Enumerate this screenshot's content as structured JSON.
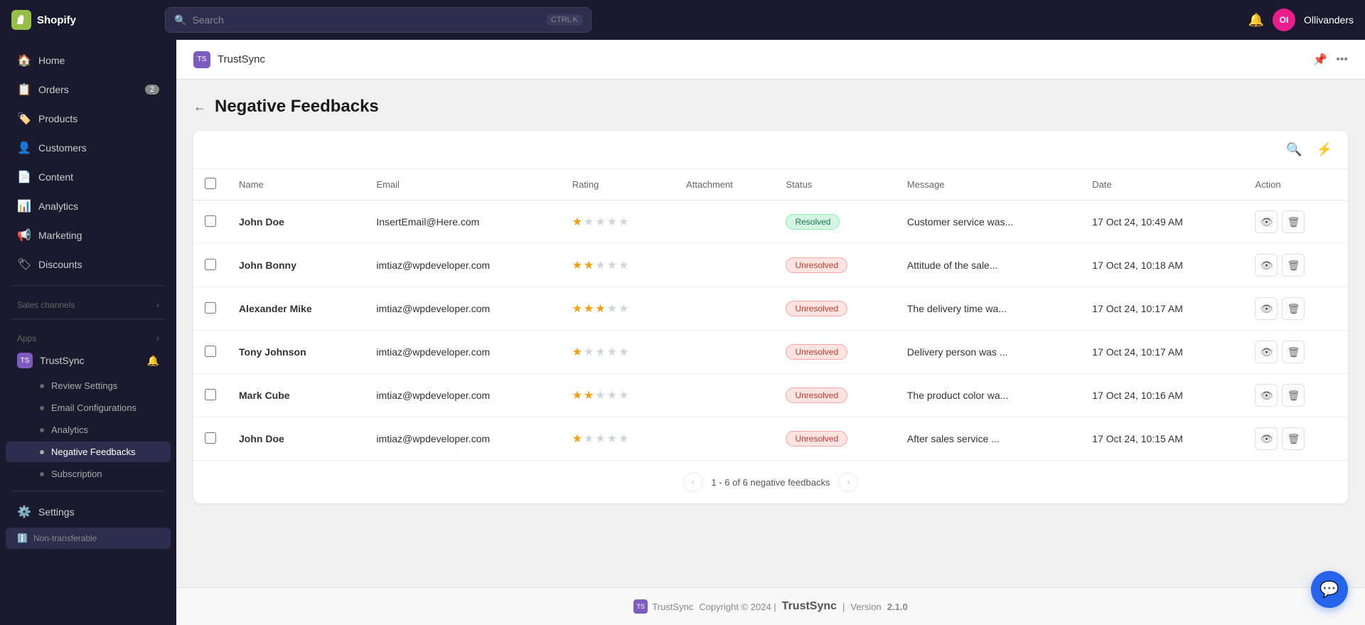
{
  "topbar": {
    "brand": "Shopify",
    "search_placeholder": "Search",
    "search_shortcut": [
      "CTRL",
      "K"
    ],
    "user_initials": "OI",
    "user_name": "Ollivanders"
  },
  "sidebar": {
    "nav_items": [
      {
        "id": "home",
        "label": "Home",
        "icon": "🏠",
        "badge": null
      },
      {
        "id": "orders",
        "label": "Orders",
        "icon": "📋",
        "badge": "2"
      },
      {
        "id": "products",
        "label": "Products",
        "icon": "🏷️",
        "badge": null
      },
      {
        "id": "customers",
        "label": "Customers",
        "icon": "👤",
        "badge": null
      },
      {
        "id": "content",
        "label": "Content",
        "icon": "📄",
        "badge": null
      },
      {
        "id": "analytics",
        "label": "Analytics",
        "icon": "📊",
        "badge": null
      },
      {
        "id": "marketing",
        "label": "Marketing",
        "icon": "📢",
        "badge": null
      },
      {
        "id": "discounts",
        "label": "Discounts",
        "icon": "🏷",
        "badge": null
      }
    ],
    "sales_channels_label": "Sales channels",
    "apps_label": "Apps",
    "trustsync_label": "TrustSync",
    "sub_items": [
      {
        "id": "review-settings",
        "label": "Review Settings"
      },
      {
        "id": "email-configurations",
        "label": "Email Configurations"
      },
      {
        "id": "analytics",
        "label": "Analytics"
      },
      {
        "id": "negative-feedbacks",
        "label": "Negative Feedbacks",
        "active": true
      }
    ],
    "subscription_label": "Subscription",
    "settings_label": "Settings",
    "non_transferable_label": "Non-transferable"
  },
  "app_header": {
    "icon_text": "TS",
    "title": "TrustSync",
    "pin_icon": "📌",
    "more_icon": "···"
  },
  "page": {
    "title": "Negative Feedbacks",
    "back_label": "←"
  },
  "table": {
    "columns": [
      "",
      "Name",
      "Email",
      "Rating",
      "Attachment",
      "Status",
      "Message",
      "Date",
      "Action"
    ],
    "rows": [
      {
        "name": "John Doe",
        "email": "InsertEmail@Here.com",
        "rating": 1,
        "attachment": "",
        "status": "Resolved",
        "status_type": "resolved",
        "message": "Customer service was...",
        "date": "17 Oct 24, 10:49 AM"
      },
      {
        "name": "John Bonny",
        "email": "imtiaz@wpdeveloper.com",
        "rating": 2,
        "attachment": "",
        "status": "Unresolved",
        "status_type": "unresolved",
        "message": "Attitude of the sale...",
        "date": "17 Oct 24, 10:18 AM"
      },
      {
        "name": "Alexander Mike",
        "email": "imtiaz@wpdeveloper.com",
        "rating": 3,
        "attachment": "",
        "status": "Unresolved",
        "status_type": "unresolved",
        "message": "The delivery time wa...",
        "date": "17 Oct 24, 10:17 AM"
      },
      {
        "name": "Tony Johnson",
        "email": "imtiaz@wpdeveloper.com",
        "rating": 1,
        "attachment": "",
        "status": "Unresolved",
        "status_type": "unresolved",
        "message": "Delivery person was ...",
        "date": "17 Oct 24, 10:17 AM"
      },
      {
        "name": "Mark Cube",
        "email": "imtiaz@wpdeveloper.com",
        "rating": 2,
        "attachment": "",
        "status": "Unresolved",
        "status_type": "unresolved",
        "message": "The product color wa...",
        "date": "17 Oct 24, 10:16 AM"
      },
      {
        "name": "John Doe",
        "email": "imtiaz@wpdeveloper.com",
        "rating": 1,
        "attachment": "",
        "status": "Unresolved",
        "status_type": "unresolved",
        "message": "After sales service ...",
        "date": "17 Oct 24, 10:15 AM"
      }
    ],
    "pagination": {
      "text": "1 - 6 of 6 negative feedbacks"
    }
  },
  "footer": {
    "icon_text": "TS",
    "brand": "TrustSync",
    "copyright": "Copyright © 2024 |",
    "separator": "|",
    "version_label": "Version",
    "version": "2.1.0"
  },
  "chat_icon": "💬"
}
